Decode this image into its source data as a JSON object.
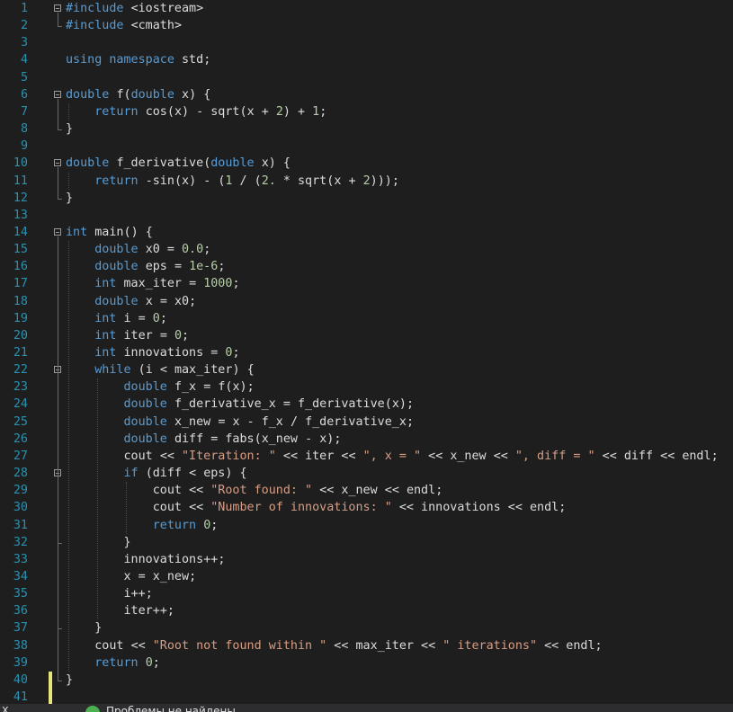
{
  "editor": {
    "lines": [
      {
        "n": "1",
        "code": "#include <iostream>"
      },
      {
        "n": "2",
        "code": "#include <cmath>"
      },
      {
        "n": "3",
        "code": ""
      },
      {
        "n": "4",
        "code": "using namespace std;"
      },
      {
        "n": "5",
        "code": ""
      },
      {
        "n": "6",
        "code": "double f(double x) {"
      },
      {
        "n": "7",
        "code": "    return cos(x) - sqrt(x + 2) + 1;"
      },
      {
        "n": "8",
        "code": "}"
      },
      {
        "n": "9",
        "code": ""
      },
      {
        "n": "10",
        "code": "double f_derivative(double x) {"
      },
      {
        "n": "11",
        "code": "    return -sin(x) - (1 / (2. * sqrt(x + 2)));"
      },
      {
        "n": "12",
        "code": "}"
      },
      {
        "n": "13",
        "code": ""
      },
      {
        "n": "14",
        "code": "int main() {"
      },
      {
        "n": "15",
        "code": "    double x0 = 0.0;"
      },
      {
        "n": "16",
        "code": "    double eps = 1e-6;"
      },
      {
        "n": "17",
        "code": "    int max_iter = 1000;"
      },
      {
        "n": "18",
        "code": "    double x = x0;"
      },
      {
        "n": "19",
        "code": "    int i = 0;"
      },
      {
        "n": "20",
        "code": "    int iter = 0;"
      },
      {
        "n": "21",
        "code": "    int innovations = 0;"
      },
      {
        "n": "22",
        "code": "    while (i < max_iter) {"
      },
      {
        "n": "23",
        "code": "        double f_x = f(x);"
      },
      {
        "n": "24",
        "code": "        double f_derivative_x = f_derivative(x);"
      },
      {
        "n": "25",
        "code": "        double x_new = x - f_x / f_derivative_x;"
      },
      {
        "n": "26",
        "code": "        double diff = fabs(x_new - x);"
      },
      {
        "n": "27",
        "code": "        cout << \"Iteration: \" << iter << \", x = \" << x_new << \", diff = \" << diff << endl;"
      },
      {
        "n": "28",
        "code": "        if (diff < eps) {"
      },
      {
        "n": "29",
        "code": "            cout << \"Root found: \" << x_new << endl;"
      },
      {
        "n": "30",
        "code": "            cout << \"Number of innovations: \" << innovations << endl;"
      },
      {
        "n": "31",
        "code": "            return 0;"
      },
      {
        "n": "32",
        "code": "        }"
      },
      {
        "n": "33",
        "code": "        innovations++;"
      },
      {
        "n": "34",
        "code": "        x = x_new;"
      },
      {
        "n": "35",
        "code": "        i++;"
      },
      {
        "n": "36",
        "code": "        iter++;"
      },
      {
        "n": "37",
        "code": "    }"
      },
      {
        "n": "38",
        "code": "    cout << \"Root not found within \" << max_iter << \" iterations\" << endl;"
      },
      {
        "n": "39",
        "code": "    return 0;"
      },
      {
        "n": "40",
        "code": "}"
      },
      {
        "n": "41",
        "code": ""
      }
    ]
  },
  "colors": {
    "background": "#1e1e1e",
    "keyword": "#569cd6",
    "string": "#d69d85",
    "number": "#b5cea8",
    "line_number": "#2b91af",
    "text": "#dcdcdc",
    "change_marker": "#e6e67a",
    "ok_status": "#4caf50"
  },
  "statusbar": {
    "left_glyph": "X",
    "status_icon": "check-circle-icon",
    "message": "Проблемы не найдены"
  }
}
